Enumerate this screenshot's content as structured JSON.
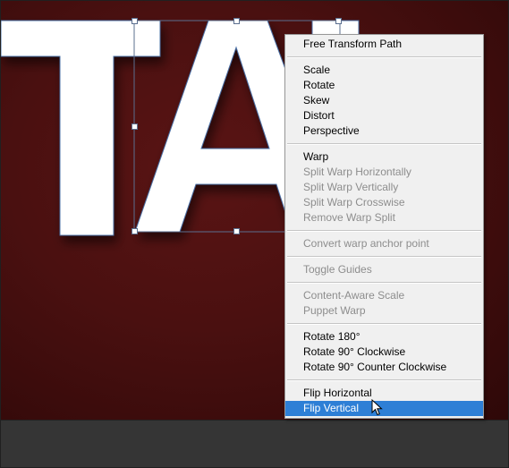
{
  "menu": {
    "free_transform_path": "Free Transform Path",
    "scale": "Scale",
    "rotate": "Rotate",
    "skew": "Skew",
    "distort": "Distort",
    "perspective": "Perspective",
    "warp": "Warp",
    "split_warp_horizontally": "Split Warp Horizontally",
    "split_warp_vertically": "Split Warp Vertically",
    "split_warp_crosswise": "Split Warp Crosswise",
    "remove_warp_split": "Remove Warp Split",
    "convert_warp_anchor_point": "Convert warp anchor point",
    "toggle_guides": "Toggle Guides",
    "content_aware_scale": "Content-Aware Scale",
    "puppet_warp": "Puppet Warp",
    "rotate_180": "Rotate 180°",
    "rotate_90_cw": "Rotate 90° Clockwise",
    "rotate_90_ccw": "Rotate 90° Counter Clockwise",
    "flip_horizontal": "Flip Horizontal",
    "flip_vertical": "Flip Vertical"
  },
  "colors": {
    "canvas_background": "#4a1010",
    "highlight": "#2e7fd6",
    "letter_fill": "#ffffff",
    "selection_outline": "#4a6fa5"
  },
  "icons": {
    "pointer": "mouse-pointer-icon"
  }
}
